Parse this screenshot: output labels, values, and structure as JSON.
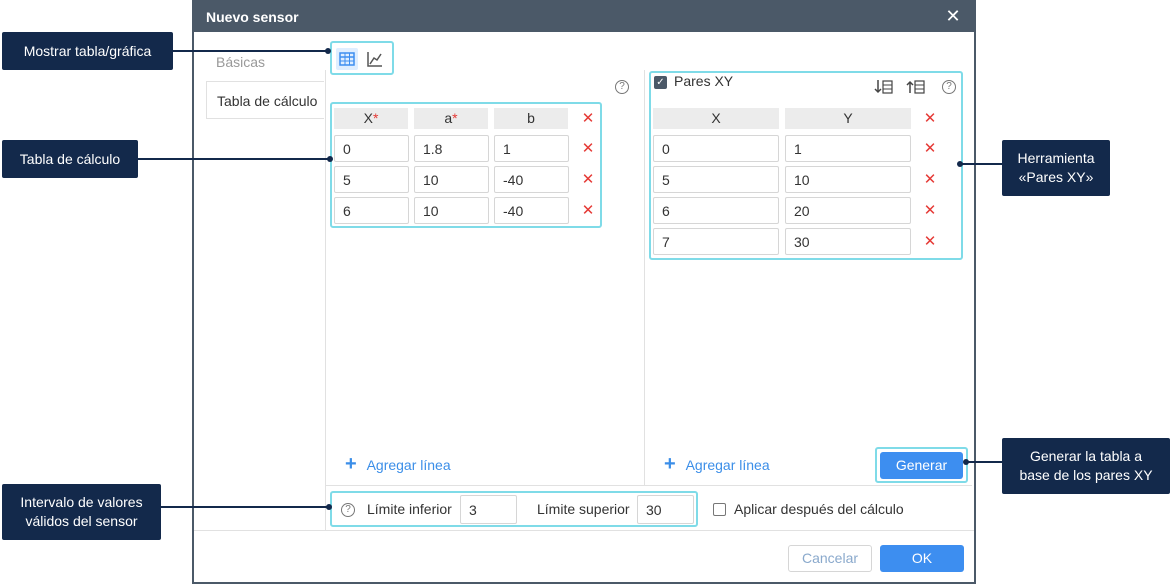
{
  "dialog": {
    "title": "Nuevo sensor",
    "close_glyph": "✕"
  },
  "tabs": [
    {
      "label": "Básicas"
    },
    {
      "label": "Tabla de cálculo"
    }
  ],
  "table": {
    "headers": [
      "X",
      "a",
      "b"
    ],
    "required_mark": "*",
    "rows": [
      [
        "0",
        "1.8",
        "1"
      ],
      [
        "5",
        "10",
        "-40"
      ],
      [
        "6",
        "10",
        "-40"
      ]
    ]
  },
  "xy": {
    "label": "Pares XY",
    "checked": true,
    "headers": [
      "X",
      "Y"
    ],
    "rows": [
      [
        "0",
        "1"
      ],
      [
        "5",
        "10"
      ],
      [
        "6",
        "20"
      ],
      [
        "7",
        "30"
      ]
    ]
  },
  "add_line_label": "Agregar línea",
  "generate_label": "Generar",
  "limits": {
    "lower_label": "Límite inferior",
    "lower_value": "3",
    "upper_label": "Límite superior",
    "upper_value": "30",
    "apply_label": "Aplicar después del cálculo"
  },
  "footer": {
    "cancel_label": "Cancelar",
    "ok_label": "OK"
  },
  "callouts": {
    "show_toggle": "Mostrar tabla/gráfica",
    "calc_table": "Tabla de cálculo",
    "xy_tool_line1": "Herramienta",
    "xy_tool_line2": "«Pares XY»",
    "generate_line1": "Generar la tabla a",
    "generate_line2": "base de los pares XY",
    "interval_line1": "Intervalo de valores",
    "interval_line2": "válidos del sensor"
  },
  "icons": {
    "help": "?",
    "delete": "✕",
    "check": "✓"
  },
  "colors": {
    "titlebar": "#4b5968",
    "accent": "#3d8ef0",
    "highlight": "#7fdbe8",
    "callout": "#13294b",
    "delete": "#e53935"
  }
}
